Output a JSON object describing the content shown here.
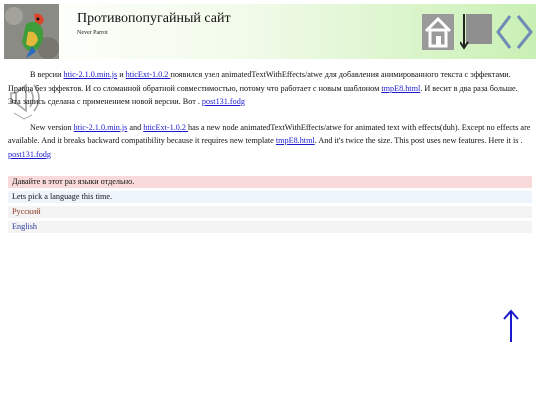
{
  "header": {
    "title": "Противопопугайный сайт",
    "subtitle": "Never Parrot",
    "logo_icon": "parrot-logo",
    "nav": {
      "home_icon": "home-icon",
      "index_icon": "index-down-icon",
      "prev_icon": "chevron-left-icon",
      "next_icon": "chevron-right-icon"
    }
  },
  "content": {
    "ru": {
      "t1": "В версии ",
      "link1": "htic-2.1.0.min.js",
      "t2": " и ",
      "link2": "hticExt-1.0.2 ",
      "t3": "появился узел animatedTextWithEffects/atwe для добавления анимированного текста с эффектами. Правда без эффектов. И со сломанной обратной совместимостью, потому что работает с новым шаблоном ",
      "link3": "tmpE8.html",
      "t4": ". И весит в два раза больше. Эта запись сделана с применением новой версии. Вот . ",
      "link4": "post131.fodg"
    },
    "en": {
      "t1": "New version ",
      "link1": "htic-2.1.0.min.js",
      "t2": " and ",
      "link2": "hticExt-1.0.2 ",
      "t3": "has a new node animatedTextWithEffects/atwe for animated text with effects(duh). Except no effects are available. And it breaks backward compatibility because it requires new template ",
      "link3": "tmpE8.html",
      "t4": ". And it's twice the size. This post uses new features. Here it is . ",
      "link4": "post131.fodg"
    }
  },
  "language": {
    "prompt_ru": "Давайте в этот раз языки отдельно.",
    "prompt_en": "Lets pick a language this time.",
    "options": [
      "Русский",
      "English"
    ]
  },
  "footer": {
    "up_icon": "arrow-up-icon"
  },
  "colors": {
    "accent": "#1a1acc",
    "header_gradient_end": "#c9f0b4",
    "prompt_ru_bg": "#f9dada",
    "prompt_en_bg": "#eef4fc"
  }
}
